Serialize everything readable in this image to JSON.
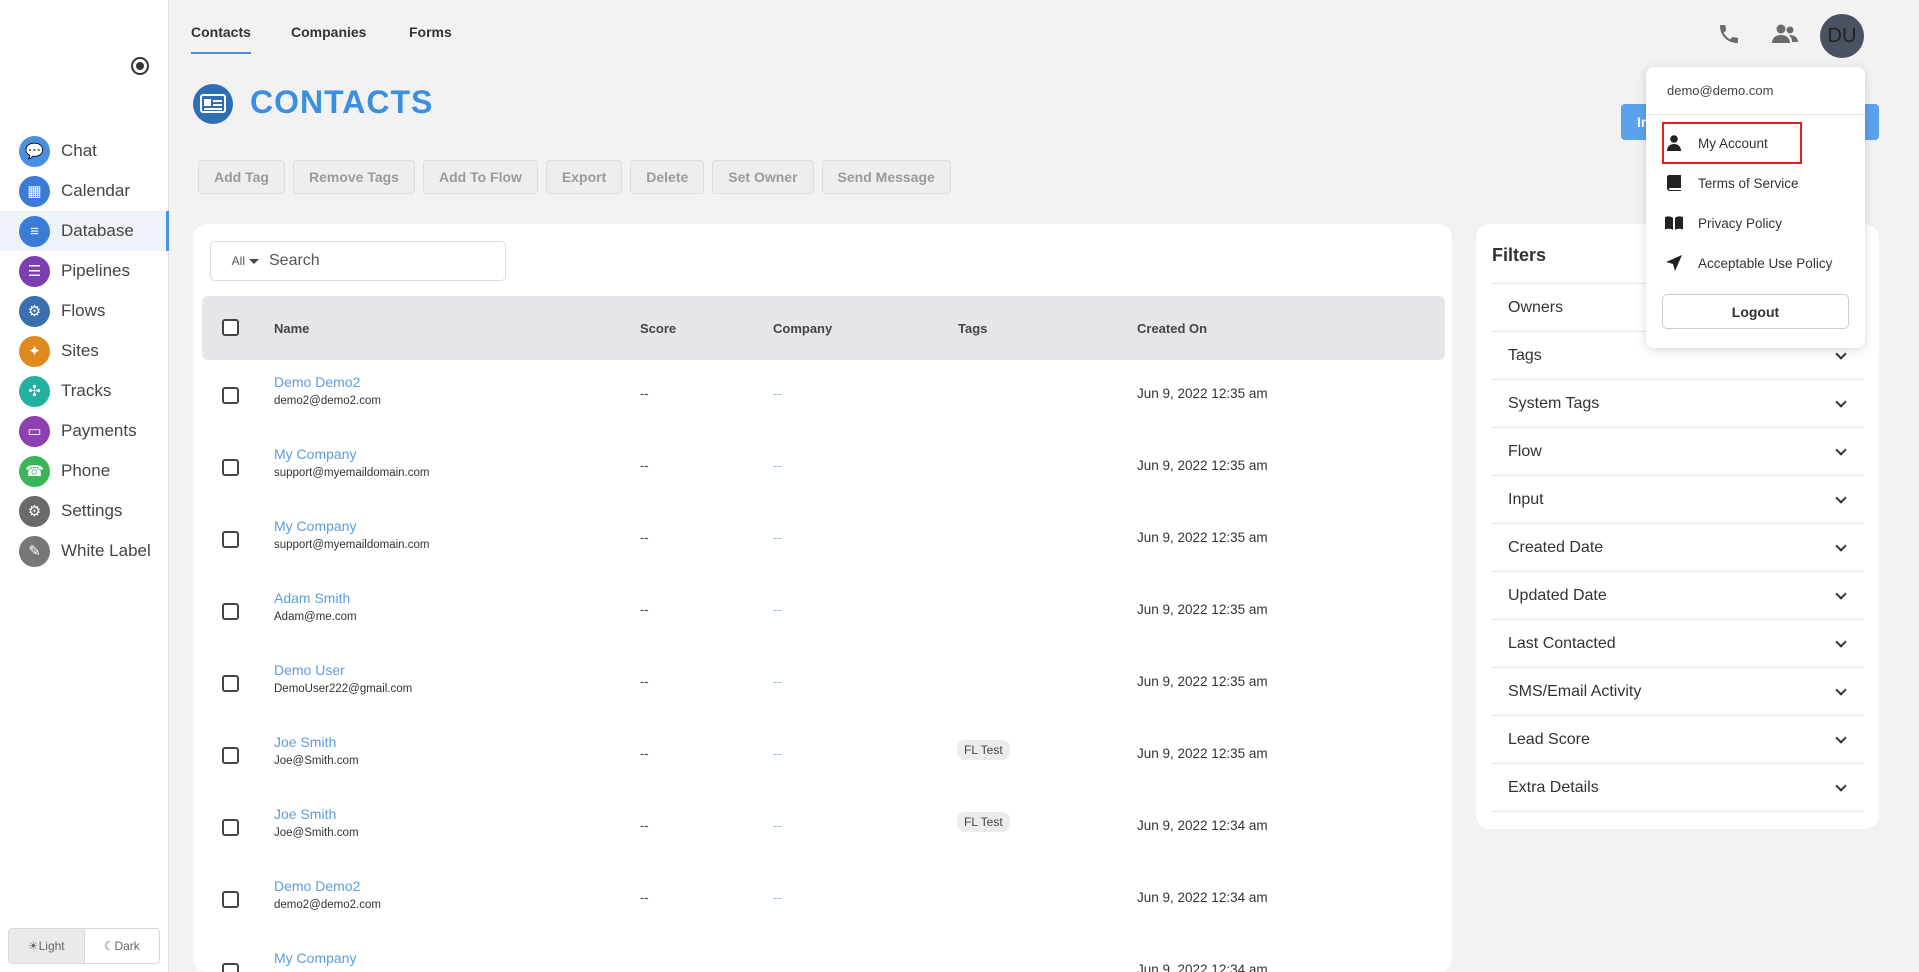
{
  "sidebar": {
    "items": [
      {
        "label": "Chat",
        "color": "#4a90e2"
      },
      {
        "label": "Calendar",
        "color": "#3a7bd5"
      },
      {
        "label": "Database",
        "color": "#3a7bd5"
      },
      {
        "label": "Pipelines",
        "color": "#7b3fb2"
      },
      {
        "label": "Flows",
        "color": "#3a6fb0"
      },
      {
        "label": "Sites",
        "color": "#e08a1e"
      },
      {
        "label": "Tracks",
        "color": "#22b0a0"
      },
      {
        "label": "Payments",
        "color": "#8e3fb2"
      },
      {
        "label": "Phone",
        "color": "#3cb55a"
      },
      {
        "label": "Settings",
        "color": "#6a6a6a"
      },
      {
        "label": "White Label",
        "color": "#777777"
      }
    ],
    "active": "Database",
    "theme": {
      "light": "☀Light",
      "dark": "☾Dark"
    }
  },
  "topbar": {
    "tabs": [
      "Contacts",
      "Companies",
      "Forms"
    ],
    "active_tab": "Contacts",
    "avatar": "DU"
  },
  "page": {
    "title": "CONTACTS",
    "import_label": "In"
  },
  "toolbar": [
    "Add Tag",
    "Remove Tags",
    "Add To Flow",
    "Export",
    "Delete",
    "Set Owner",
    "Send Message"
  ],
  "search": {
    "filter": "All",
    "placeholder": "Search"
  },
  "table": {
    "columns": [
      "Name",
      "Score",
      "Company",
      "Tags",
      "Created On"
    ],
    "rows": [
      {
        "name": "Demo Demo2",
        "email": "demo2@demo2.com",
        "score": "--",
        "company": "--",
        "tag": "",
        "created": "Jun 9, 2022 12:35 am"
      },
      {
        "name": "My Company",
        "email": "support@myemaildomain.com",
        "score": "--",
        "company": "--",
        "tag": "",
        "created": "Jun 9, 2022 12:35 am"
      },
      {
        "name": "My Company",
        "email": "support@myemaildomain.com",
        "score": "--",
        "company": "--",
        "tag": "",
        "created": "Jun 9, 2022 12:35 am"
      },
      {
        "name": "Adam Smith",
        "email": "Adam@me.com",
        "score": "--",
        "company": "--",
        "tag": "",
        "created": "Jun 9, 2022 12:35 am"
      },
      {
        "name": "Demo User",
        "email": "DemoUser222@gmail.com",
        "score": "--",
        "company": "--",
        "tag": "",
        "created": "Jun 9, 2022 12:35 am"
      },
      {
        "name": "Joe Smith",
        "email": "Joe@Smith.com",
        "score": "--",
        "company": "--",
        "tag": "FL Test",
        "created": "Jun 9, 2022 12:35 am"
      },
      {
        "name": "Joe Smith",
        "email": "Joe@Smith.com",
        "score": "--",
        "company": "--",
        "tag": "FL Test",
        "created": "Jun 9, 2022 12:34 am"
      },
      {
        "name": "Demo Demo2",
        "email": "demo2@demo2.com",
        "score": "--",
        "company": "--",
        "tag": "",
        "created": "Jun 9, 2022 12:34 am"
      },
      {
        "name": "My Company",
        "email": "",
        "score": "",
        "company": "",
        "tag": "",
        "created": "Jun 9, 2022 12:34 am"
      }
    ]
  },
  "filters": {
    "title": "Filters",
    "items": [
      "Owners",
      "Tags",
      "System Tags",
      "Flow",
      "Input",
      "Created Date",
      "Updated Date",
      "Last Contacted",
      "SMS/Email Activity",
      "Lead Score",
      "Extra Details"
    ]
  },
  "account_menu": {
    "email": "demo@demo.com",
    "items": [
      {
        "label": "My Account",
        "icon": "person-icon"
      },
      {
        "label": "Terms of Service",
        "icon": "book-icon"
      },
      {
        "label": "Privacy Policy",
        "icon": "open-book-icon"
      },
      {
        "label": "Acceptable Use Policy",
        "icon": "send-arrow-icon"
      }
    ],
    "highlighted": "My Account",
    "logout": "Logout"
  }
}
